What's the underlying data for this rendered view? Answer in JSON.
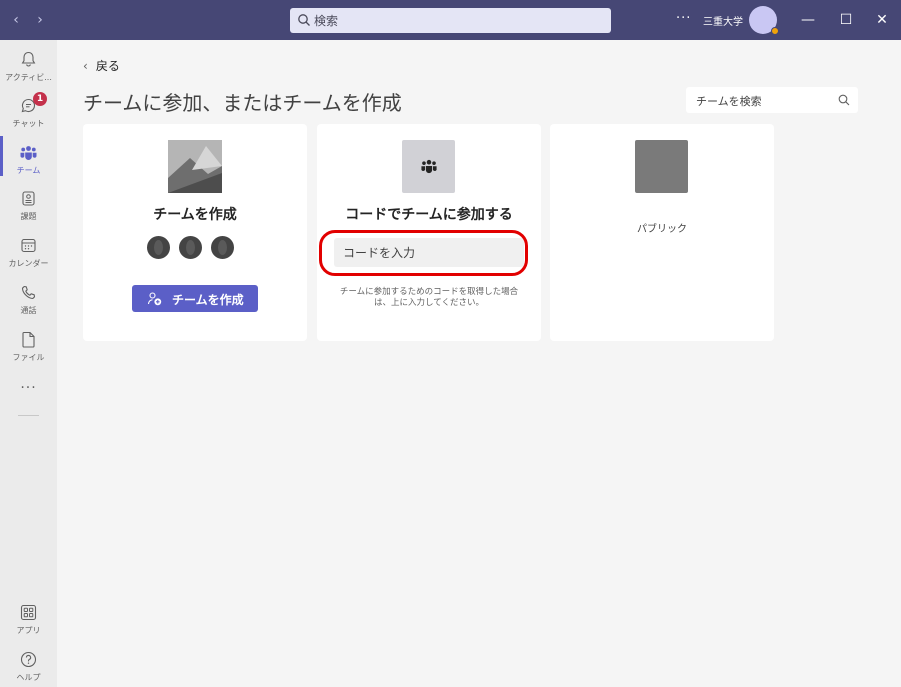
{
  "titlebar": {
    "back_arrow": "‹",
    "forward_arrow": "›",
    "search_placeholder": "検索",
    "more": "···",
    "org_name": "三重大学",
    "window_minimize": "—",
    "window_maximize": "☐",
    "window_close": "✕"
  },
  "rail": {
    "items": [
      {
        "label": "アクティビ...",
        "icon": "bell-icon"
      },
      {
        "label": "チャット",
        "icon": "chat-icon",
        "badge": "1"
      },
      {
        "label": "チーム",
        "icon": "teams-icon",
        "active": true
      },
      {
        "label": "課題",
        "icon": "assignments-icon"
      },
      {
        "label": "カレンダー",
        "icon": "calendar-icon"
      },
      {
        "label": "通話",
        "icon": "phone-icon"
      },
      {
        "label": "ファイル",
        "icon": "file-icon"
      }
    ],
    "more": "···",
    "bottom": [
      {
        "label": "アプリ",
        "icon": "apps-icon"
      },
      {
        "label": "ヘルプ",
        "icon": "help-icon"
      }
    ]
  },
  "main": {
    "back_label": "戻る",
    "back_chevron": "‹",
    "title": "チームに参加、またはチームを作成",
    "team_search_placeholder": "チームを検索",
    "cards": {
      "create": {
        "title": "チームを作成",
        "button_label": "チームを作成"
      },
      "join_code": {
        "title": "コードでチームに参加する",
        "input_placeholder": "コードを入力",
        "hint": "チームに参加するためのコードを取得した場合は、上に入力してください。"
      },
      "public": {
        "label": "パブリック"
      }
    }
  },
  "colors": {
    "titlebar": "#464775",
    "accent": "#5b5fc7",
    "highlight_ring": "#e20000",
    "badge": "#c4314b"
  }
}
